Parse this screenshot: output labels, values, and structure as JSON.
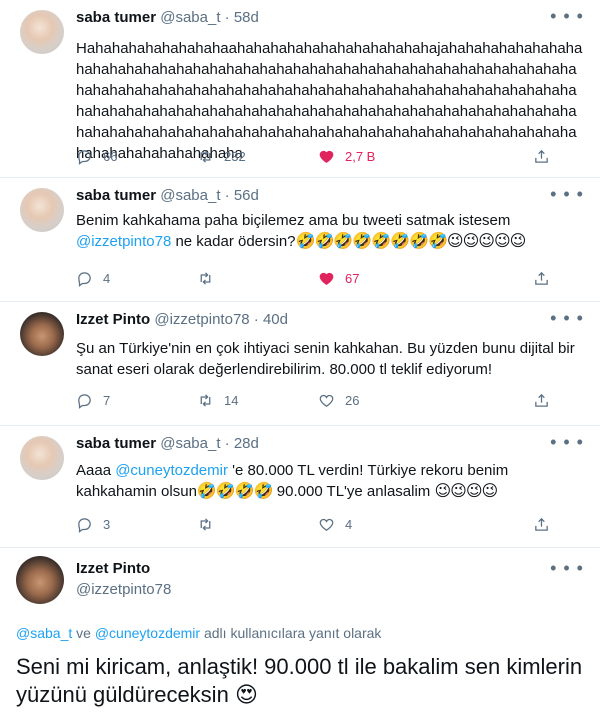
{
  "tweets": [
    {
      "name": "saba tumer",
      "handle": "@saba_t",
      "time": "58d",
      "text": "Hahahahahahahahahaahahahahahahahahahahahahajahahahahahahahahahahahahahahahahahahahahahahahahahahahahahahahahahahahahahahahahahahahahahahahahahahahahahahahahahahahahahahahahahahahahahahahahahahahahahahahahahahahahahahahahahahahahahahahahahahahahahahahahahahahahahahahahahahahahahahahahahahahahahahahahahahahahahahahahahaha",
      "replies": "66",
      "retweets": "232",
      "likes": "2,7 B"
    },
    {
      "name": "saba tumer",
      "handle": "@saba_t",
      "time": "56d",
      "text_before": "Benim kahkahama paha biçilemez ama bu tweeti satmak istesem",
      "mention": "@izzetpinto78",
      "text_after": " ne kadar ödersin?",
      "emojis": "🤣🤣🤣🤣🤣🤣🤣🤣😉😉😉😉😉",
      "replies": "4",
      "retweets": "",
      "likes": "67"
    },
    {
      "name": "Izzet Pinto",
      "handle": "@izzetpinto78",
      "time": "40d",
      "text": "Şu an Türkiye'nin en çok ihtiyaci senin kahkahan. Bu yüzden bunu dijital bir sanat eseri olarak değerlendirebilirim. 80.000 tl teklif ediyorum!",
      "replies": "7",
      "retweets": "14",
      "likes": "26"
    },
    {
      "name": "saba tumer",
      "handle": "@saba_t",
      "time": "28d",
      "text_before": "Aaaa ",
      "mention": "@cuneytozdemir",
      "text_after": " 'e 80.000 TL verdin! Türkiye rekoru benim kahkahamin olsun",
      "emojis_1": "🤣🤣🤣🤣",
      "text_after_2": " 90.000 TL'ye anlasalim ",
      "emojis_2": "😉😉😉😉",
      "replies": "3",
      "retweets": "",
      "likes": "4"
    }
  ],
  "main_tweet": {
    "name": "Izzet Pinto",
    "handle": "@izzetpinto78",
    "reply_mention_1": "@saba_t",
    "reply_and": " ve ",
    "reply_mention_2": "@cuneytozdemir",
    "reply_suffix": " adlı kullanıcılara yanıt olarak",
    "text": "Seni mi kiricam, anlaştik! 90.000 tl ile bakalim sen kimlerin yüzünü güldüreceksin",
    "emoji": "😍"
  },
  "colors": {
    "accent": "#1da1f2",
    "like": "#e0245e",
    "muted": "#5b7083"
  },
  "more_glyph": "• • •",
  "separator": "·"
}
